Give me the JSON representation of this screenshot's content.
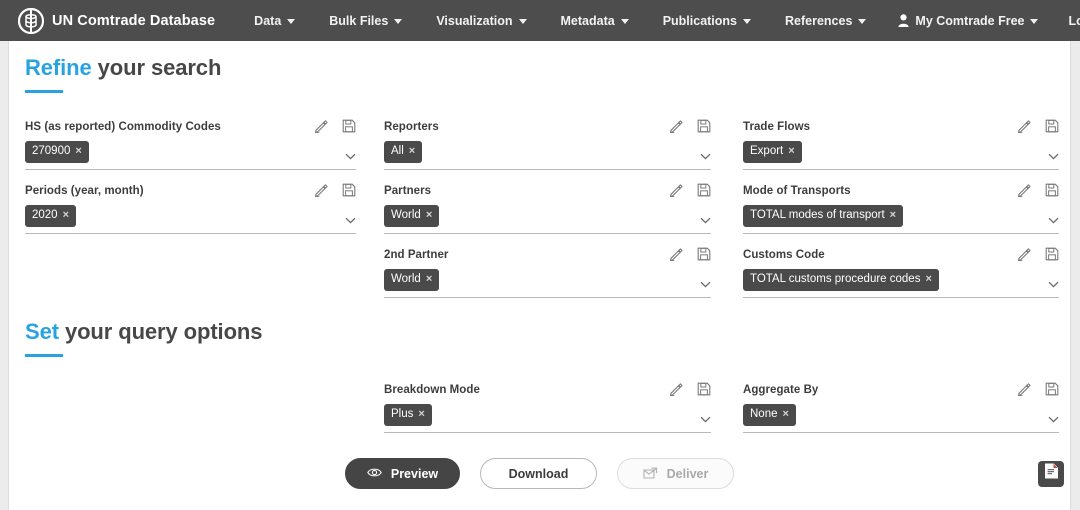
{
  "navbar": {
    "brand": "UN Comtrade Database",
    "logo_icon": "comtrade-logo-icon",
    "items": [
      {
        "label": "Data",
        "caret": true
      },
      {
        "label": "Bulk Files",
        "caret": true
      },
      {
        "label": "Visualization",
        "caret": true
      },
      {
        "label": "Metadata",
        "caret": true
      },
      {
        "label": "Publications",
        "caret": true
      },
      {
        "label": "References",
        "caret": true
      }
    ],
    "account": {
      "label": "My Comtrade Free",
      "icon": "user-icon",
      "caret": true
    },
    "logout": {
      "label": "Logout"
    }
  },
  "refine": {
    "title_accent": "Refine",
    "title_rest": " your search",
    "columns": [
      {
        "fields": [
          {
            "label": "HS (as reported) Commodity Codes",
            "chips": [
              "270900"
            ],
            "edit_icon": "pencil-icon",
            "save_icon": "floppy-disk-icon",
            "caret_icon": "chevron-down-icon"
          },
          {
            "label": "Periods (year, month)",
            "chips": [
              "2020"
            ],
            "edit_icon": "pencil-icon",
            "save_icon": "floppy-disk-icon",
            "caret_icon": "chevron-down-icon"
          }
        ]
      },
      {
        "fields": [
          {
            "label": "Reporters",
            "chips": [
              "All"
            ],
            "edit_icon": "pencil-icon",
            "save_icon": "floppy-disk-icon",
            "caret_icon": "chevron-down-icon"
          },
          {
            "label": "Partners",
            "chips": [
              "World"
            ],
            "edit_icon": "pencil-icon",
            "save_icon": "floppy-disk-icon",
            "caret_icon": "chevron-down-icon"
          },
          {
            "label": "2nd Partner",
            "chips": [
              "World"
            ],
            "edit_icon": "pencil-icon",
            "save_icon": "floppy-disk-icon",
            "caret_icon": "chevron-down-icon"
          }
        ]
      },
      {
        "fields": [
          {
            "label": "Trade Flows",
            "chips": [
              "Export"
            ],
            "edit_icon": "pencil-icon",
            "save_icon": "floppy-disk-icon",
            "caret_icon": "chevron-down-icon"
          },
          {
            "label": "Mode of Transports",
            "chips": [
              "TOTAL modes of transport"
            ],
            "edit_icon": "pencil-icon",
            "save_icon": "floppy-disk-icon",
            "caret_icon": "chevron-down-icon"
          },
          {
            "label": "Customs Code",
            "chips": [
              "TOTAL customs procedure codes"
            ],
            "edit_icon": "pencil-icon",
            "save_icon": "floppy-disk-icon",
            "caret_icon": "chevron-down-icon"
          }
        ]
      }
    ]
  },
  "query_options": {
    "title_accent": "Set",
    "title_rest": " your query options",
    "breakdown": {
      "label": "Breakdown Mode",
      "chips": [
        "Plus"
      ],
      "edit_icon": "pencil-icon",
      "save_icon": "floppy-disk-icon",
      "caret_icon": "chevron-down-icon"
    },
    "aggregate": {
      "label": "Aggregate By",
      "chips": [
        "None"
      ],
      "edit_icon": "pencil-icon",
      "save_icon": "floppy-disk-icon",
      "caret_icon": "chevron-down-icon"
    }
  },
  "actions": {
    "preview": {
      "label": "Preview",
      "icon": "eye-icon",
      "state": "active"
    },
    "download": {
      "label": "Download",
      "state": "enabled"
    },
    "deliver": {
      "label": "Deliver",
      "icon": "deliver-icon",
      "state": "disabled"
    },
    "save_query": {
      "icon": "save-file-icon",
      "title": "Save query"
    }
  },
  "colors": {
    "accent": "#29a3e0",
    "navbar_bg": "#4d4d4d",
    "chip_bg": "#4a4a4a",
    "primary_btn": "#454545"
  }
}
